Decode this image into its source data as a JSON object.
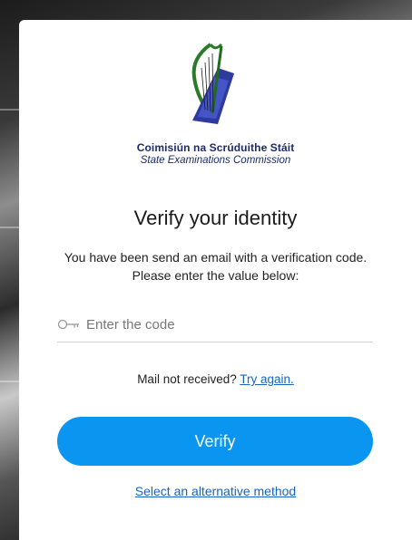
{
  "colors": {
    "accent": "#0a95f0",
    "link": "#1565c0",
    "brand": "#1d2a6b"
  },
  "organization": {
    "name_ga": "Coimisiún na Scrúduithe Stáit",
    "name_en": "State Examinations Commission",
    "logo_icon": "harp-logo-icon"
  },
  "verify": {
    "title": "Verify your identity",
    "description": "You have been send an email with a verification code. Please enter the value below:",
    "code_input": {
      "icon": "key-icon",
      "placeholder": "Enter the code",
      "value": ""
    },
    "resend_text": "Mail not received?",
    "resend_link": "Try again.",
    "submit_label": "Verify",
    "alternative_link": "Select an alternative method"
  }
}
